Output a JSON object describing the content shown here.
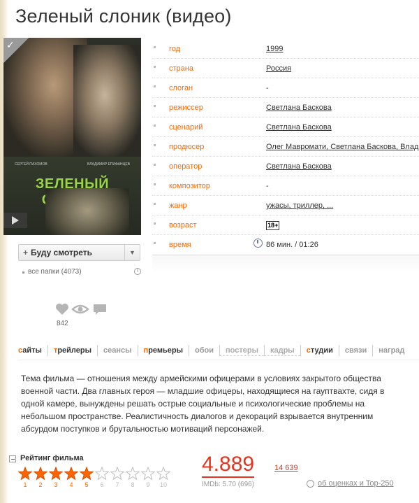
{
  "title": "Зеленый слоник (видео)",
  "info": [
    {
      "label": "год",
      "value": "1999",
      "link": true
    },
    {
      "label": "страна",
      "value": "Россия",
      "link": true
    },
    {
      "label": "слоган",
      "value": "-",
      "link": false
    },
    {
      "label": "режиссер",
      "value": "Светлана Баскова",
      "link": true
    },
    {
      "label": "сценарий",
      "value": "Светлана Баскова",
      "link": true
    },
    {
      "label": "продюсер",
      "value": "Олег Мавромати, Светлана Баскова, Влади",
      "link": true
    },
    {
      "label": "оператор",
      "value": "Светлана Баскова",
      "link": true
    },
    {
      "label": "композитор",
      "value": "-",
      "link": false
    },
    {
      "label": "жанр",
      "value": "ужасы, триллер, ...",
      "link": true
    },
    {
      "label": "возраст",
      "value": "18+",
      "link": false
    },
    {
      "label": "время",
      "value": "86 мин. / 01:26",
      "link": false
    }
  ],
  "poster": {
    "title": "ЗЕЛЕНЫЙ СЛОНИК",
    "actor_left": "СЕРГЕЙ ПАХОМОВ",
    "actor_right": "ВЛАДИМИР ЕПИФАНЦЕВ"
  },
  "watch_button": {
    "label": "Буду смотреть"
  },
  "folders": {
    "label": "все папки (4073)"
  },
  "likes": {
    "count": "842"
  },
  "tabs": [
    {
      "label": "сайты",
      "active": true,
      "dim": false
    },
    {
      "label": "трейлеры",
      "active": true,
      "dim": false
    },
    {
      "label": "сеансы",
      "active": false,
      "dim": false
    },
    {
      "label": "премьеры",
      "active": true,
      "dim": false
    },
    {
      "label": "обои",
      "active": false,
      "dim": false
    },
    {
      "label": "постеры",
      "active": false,
      "dim": true
    },
    {
      "label": "кадры",
      "active": false,
      "dim": true
    },
    {
      "label": "студии",
      "active": true,
      "dim": false
    },
    {
      "label": "связи",
      "active": false,
      "dim": false
    },
    {
      "label": "наград",
      "active": false,
      "dim": false
    }
  ],
  "synopsis": "Тема фильма — отношения между армейскими офицерами в условиях закрытого общества военной части. Два главных героя — младшие офицеры, находящиеся на гауптвахте, сидя в одной камере, вынуждены решать острые социальные и психологические проблемы на небольшом пространстве. Реалистичность диалогов и декораций взрывается внутренним абсурдом поступков и брутальностью мотиваций персонажей.",
  "rating": {
    "title": "Рейтинг фильма",
    "score": "4.889",
    "votes": "14 639",
    "imdb": "IMDb: 5.70 (696)",
    "top250_link": "об оценках и Top-250",
    "stars_filled": 5,
    "stars_total": 10,
    "star_labels": [
      "1",
      "2",
      "3",
      "4",
      "5",
      "6",
      "7",
      "8",
      "9",
      "10"
    ]
  },
  "colors": {
    "accent": "#ff6600",
    "rating_red": "#e8321c"
  }
}
